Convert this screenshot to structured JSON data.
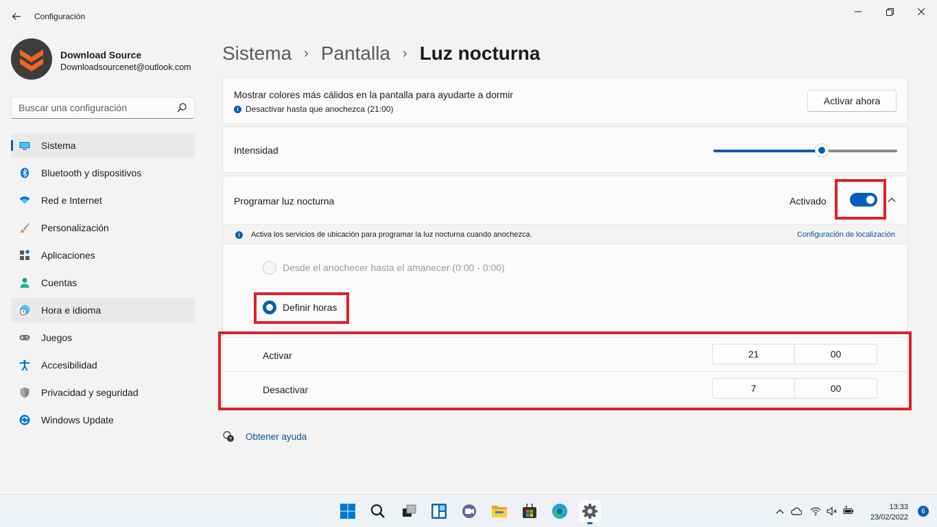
{
  "window": {
    "title": "Configuración"
  },
  "profile": {
    "name": "Download Source",
    "email": "Downloadsourcenet@outlook.com"
  },
  "search": {
    "placeholder": "Buscar una configuración"
  },
  "sidebar": {
    "items": [
      {
        "label": "Sistema",
        "icon": "monitor-icon"
      },
      {
        "label": "Bluetooth y dispositivos",
        "icon": "bluetooth-icon"
      },
      {
        "label": "Red e Internet",
        "icon": "wifi-icon"
      },
      {
        "label": "Personalización",
        "icon": "brush-icon"
      },
      {
        "label": "Aplicaciones",
        "icon": "apps-icon"
      },
      {
        "label": "Cuentas",
        "icon": "person-icon"
      },
      {
        "label": "Hora e idioma",
        "icon": "clock-globe-icon"
      },
      {
        "label": "Juegos",
        "icon": "gamepad-icon"
      },
      {
        "label": "Accesibilidad",
        "icon": "accessibility-icon"
      },
      {
        "label": "Privacidad y seguridad",
        "icon": "shield-icon"
      },
      {
        "label": "Windows Update",
        "icon": "update-icon"
      }
    ]
  },
  "breadcrumb": {
    "level1": "Sistema",
    "level2": "Pantalla",
    "current": "Luz nocturna",
    "separator": "›"
  },
  "now_card": {
    "title": "Mostrar colores más cálidos en la pantalla para ayudarte a dormir",
    "subtitle": "Desactivar hasta que anochezca (21:00)",
    "button": "Activar ahora"
  },
  "intensity": {
    "label": "Intensidad",
    "value_percent": 59
  },
  "schedule": {
    "title": "Programar luz nocturna",
    "status": "Activado",
    "enabled": true,
    "info_text": "Activa los servicios de ubicación para programar la luz nocturna cuando anochezca.",
    "info_link": "Configuración de localización",
    "option_sunset": "Desde el anochecer hasta el amanecer (0:00 - 0:00)",
    "option_hours": "Definir horas",
    "on": {
      "label": "Activar",
      "hour": "21",
      "minute": "00"
    },
    "off": {
      "label": "Desactivar",
      "hour": "7",
      "minute": "00"
    }
  },
  "help": {
    "label": "Obtener ayuda"
  },
  "taskbar": {
    "time": "13:33",
    "date": "23/02/2022",
    "notifications": "6"
  },
  "colors": {
    "accent": "#005fb8",
    "highlight": "#e0202a",
    "background": "#f3f3f3"
  }
}
